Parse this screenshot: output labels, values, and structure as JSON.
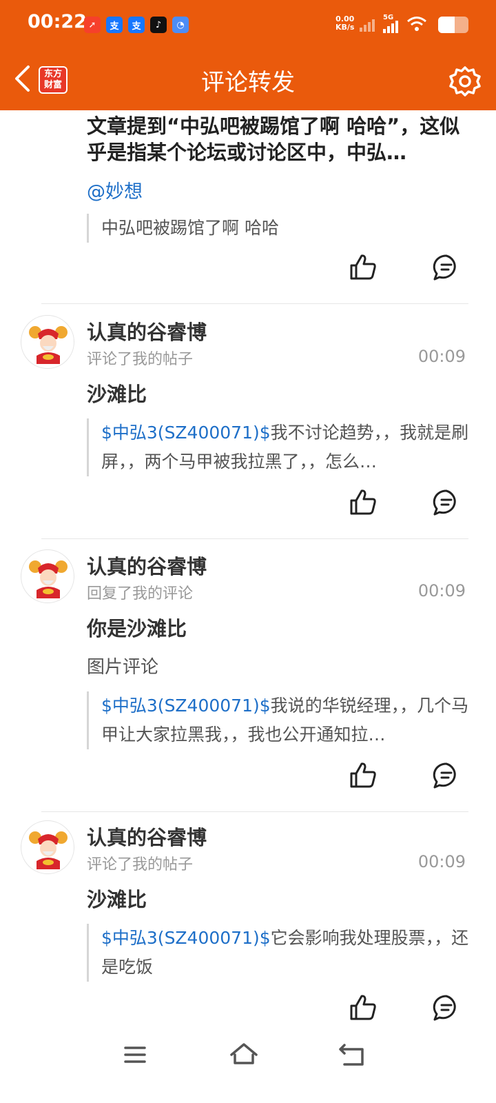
{
  "status_bar": {
    "time": "00:22",
    "apps": [
      "➚",
      "支",
      "支",
      "♪",
      "◔"
    ],
    "net_speed_value": "0.00",
    "net_speed_unit": "KB/s",
    "network": "5G",
    "battery_level": 0.55
  },
  "header": {
    "title": "评论转发",
    "logo_text_line1": "东方",
    "logo_text_line2": "财富",
    "back_icon": "chevron-left-icon",
    "settings_icon": "gear-icon"
  },
  "top_item": {
    "title": "文章提到“中弘吧被踢馆了啊 哈哈”，这似乎是指某个论坛或讨论区中，中弘…",
    "mention": "@妙想",
    "quote": "中弘吧被踢馆了啊 哈哈"
  },
  "items": [
    {
      "username": "认真的谷睿博",
      "action": "评论了我的帖子",
      "time": "00:09",
      "comment": "沙滩比",
      "image_note": "",
      "quote_stock": "$中弘3(SZ400071)$",
      "quote_text": "我不讨论趋势，，我就是刷屏，，两个马甲被我拉黑了，，怎么…"
    },
    {
      "username": "认真的谷睿博",
      "action": "回复了我的评论",
      "time": "00:09",
      "comment": "你是沙滩比",
      "image_note": "图片评论",
      "quote_stock": "$中弘3(SZ400071)$",
      "quote_text": "我说的华锐经理，，几个马甲让大家拉黑我，，我也公开通知拉…"
    },
    {
      "username": "认真的谷睿博",
      "action": "评论了我的帖子",
      "time": "00:09",
      "comment": "沙滩比",
      "image_note": "",
      "quote_stock": "$中弘3(SZ400071)$",
      "quote_text": "它会影响我处理股票，，还是吃饭"
    }
  ],
  "colors": {
    "brand": "#ea5a0c",
    "link": "#1e6fc8"
  },
  "nav_bar": {
    "menu_icon": "menu-icon",
    "home_icon": "home-icon",
    "back_icon": "back-icon"
  }
}
